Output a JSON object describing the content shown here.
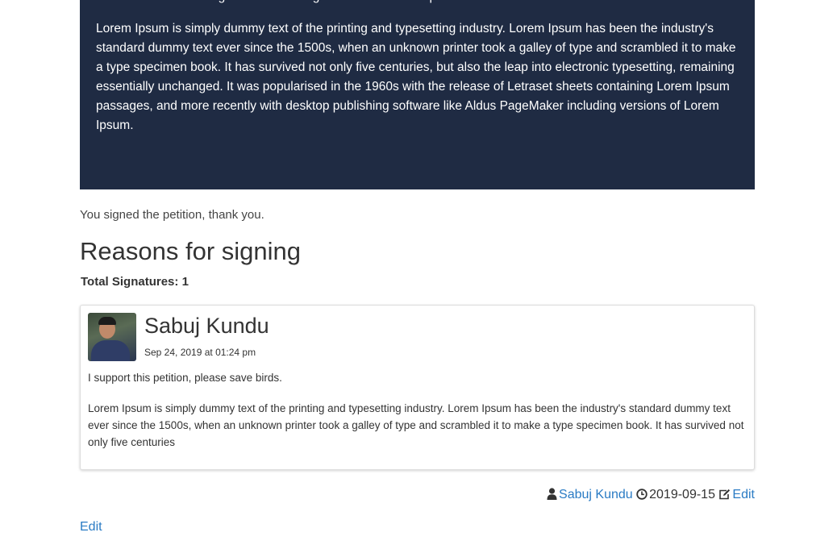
{
  "hero": {
    "partial_line": "software like Aldus PageMaker including versions of Lorem Ipsum.",
    "paragraph": "Lorem Ipsum is simply dummy text of the printing and typesetting industry. Lorem Ipsum has been the industry's standard dummy text ever since the 1500s, when an unknown printer took a galley of type and scrambled it to make a type specimen book. It has survived not only five centuries, but also the leap into electronic typesetting, remaining essentially unchanged. It was popularised in the 1960s with the release of Letraset sheets containing Lorem Ipsum passages, and more recently with desktop publishing software like Aldus PageMaker including versions of Lorem Ipsum.",
    "background_color": "#1f2b43"
  },
  "status_message": "You signed the petition, thank you.",
  "reasons": {
    "title": "Reasons for signing",
    "total_signatures": "Total Signatures: 1"
  },
  "signature_card": {
    "name": "Sabuj Kundu",
    "date": "Sep 24, 2019 at 01:24 pm",
    "reason": "I support this petition, please save birds.",
    "body": "Lorem Ipsum is simply dummy text of the printing and typesetting industry. Lorem Ipsum has been the industry's standard dummy text ever since the 1500s, when an unknown printer took a galley of type and scrambled it to make a type specimen book. It has survived not only five centuries"
  },
  "meta": {
    "author_icon": "user-icon",
    "author": "Sabuj Kundu",
    "date_icon": "clock-icon",
    "date": "2019-09-15",
    "edit_icon": "edit-icon",
    "edit_label": "Edit",
    "link_color": "#2a7bc4"
  },
  "footer": {
    "edit_label": "Edit"
  }
}
